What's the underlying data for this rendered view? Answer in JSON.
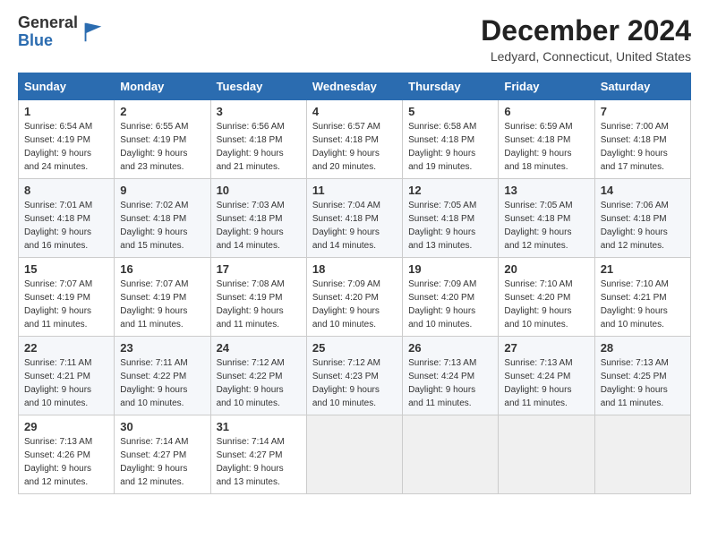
{
  "header": {
    "logo_line1": "General",
    "logo_line2": "Blue",
    "title": "December 2024",
    "subtitle": "Ledyard, Connecticut, United States"
  },
  "columns": [
    "Sunday",
    "Monday",
    "Tuesday",
    "Wednesday",
    "Thursday",
    "Friday",
    "Saturday"
  ],
  "weeks": [
    [
      {
        "day": "1",
        "sunrise": "6:54 AM",
        "sunset": "4:19 PM",
        "daylight": "9 hours and 24 minutes."
      },
      {
        "day": "2",
        "sunrise": "6:55 AM",
        "sunset": "4:19 PM",
        "daylight": "9 hours and 23 minutes."
      },
      {
        "day": "3",
        "sunrise": "6:56 AM",
        "sunset": "4:18 PM",
        "daylight": "9 hours and 21 minutes."
      },
      {
        "day": "4",
        "sunrise": "6:57 AM",
        "sunset": "4:18 PM",
        "daylight": "9 hours and 20 minutes."
      },
      {
        "day": "5",
        "sunrise": "6:58 AM",
        "sunset": "4:18 PM",
        "daylight": "9 hours and 19 minutes."
      },
      {
        "day": "6",
        "sunrise": "6:59 AM",
        "sunset": "4:18 PM",
        "daylight": "9 hours and 18 minutes."
      },
      {
        "day": "7",
        "sunrise": "7:00 AM",
        "sunset": "4:18 PM",
        "daylight": "9 hours and 17 minutes."
      }
    ],
    [
      {
        "day": "8",
        "sunrise": "7:01 AM",
        "sunset": "4:18 PM",
        "daylight": "9 hours and 16 minutes."
      },
      {
        "day": "9",
        "sunrise": "7:02 AM",
        "sunset": "4:18 PM",
        "daylight": "9 hours and 15 minutes."
      },
      {
        "day": "10",
        "sunrise": "7:03 AM",
        "sunset": "4:18 PM",
        "daylight": "9 hours and 14 minutes."
      },
      {
        "day": "11",
        "sunrise": "7:04 AM",
        "sunset": "4:18 PM",
        "daylight": "9 hours and 14 minutes."
      },
      {
        "day": "12",
        "sunrise": "7:05 AM",
        "sunset": "4:18 PM",
        "daylight": "9 hours and 13 minutes."
      },
      {
        "day": "13",
        "sunrise": "7:05 AM",
        "sunset": "4:18 PM",
        "daylight": "9 hours and 12 minutes."
      },
      {
        "day": "14",
        "sunrise": "7:06 AM",
        "sunset": "4:18 PM",
        "daylight": "9 hours and 12 minutes."
      }
    ],
    [
      {
        "day": "15",
        "sunrise": "7:07 AM",
        "sunset": "4:19 PM",
        "daylight": "9 hours and 11 minutes."
      },
      {
        "day": "16",
        "sunrise": "7:07 AM",
        "sunset": "4:19 PM",
        "daylight": "9 hours and 11 minutes."
      },
      {
        "day": "17",
        "sunrise": "7:08 AM",
        "sunset": "4:19 PM",
        "daylight": "9 hours and 11 minutes."
      },
      {
        "day": "18",
        "sunrise": "7:09 AM",
        "sunset": "4:20 PM",
        "daylight": "9 hours and 10 minutes."
      },
      {
        "day": "19",
        "sunrise": "7:09 AM",
        "sunset": "4:20 PM",
        "daylight": "9 hours and 10 minutes."
      },
      {
        "day": "20",
        "sunrise": "7:10 AM",
        "sunset": "4:20 PM",
        "daylight": "9 hours and 10 minutes."
      },
      {
        "day": "21",
        "sunrise": "7:10 AM",
        "sunset": "4:21 PM",
        "daylight": "9 hours and 10 minutes."
      }
    ],
    [
      {
        "day": "22",
        "sunrise": "7:11 AM",
        "sunset": "4:21 PM",
        "daylight": "9 hours and 10 minutes."
      },
      {
        "day": "23",
        "sunrise": "7:11 AM",
        "sunset": "4:22 PM",
        "daylight": "9 hours and 10 minutes."
      },
      {
        "day": "24",
        "sunrise": "7:12 AM",
        "sunset": "4:22 PM",
        "daylight": "9 hours and 10 minutes."
      },
      {
        "day": "25",
        "sunrise": "7:12 AM",
        "sunset": "4:23 PM",
        "daylight": "9 hours and 10 minutes."
      },
      {
        "day": "26",
        "sunrise": "7:13 AM",
        "sunset": "4:24 PM",
        "daylight": "9 hours and 11 minutes."
      },
      {
        "day": "27",
        "sunrise": "7:13 AM",
        "sunset": "4:24 PM",
        "daylight": "9 hours and 11 minutes."
      },
      {
        "day": "28",
        "sunrise": "7:13 AM",
        "sunset": "4:25 PM",
        "daylight": "9 hours and 11 minutes."
      }
    ],
    [
      {
        "day": "29",
        "sunrise": "7:13 AM",
        "sunset": "4:26 PM",
        "daylight": "9 hours and 12 minutes."
      },
      {
        "day": "30",
        "sunrise": "7:14 AM",
        "sunset": "4:27 PM",
        "daylight": "9 hours and 12 minutes."
      },
      {
        "day": "31",
        "sunrise": "7:14 AM",
        "sunset": "4:27 PM",
        "daylight": "9 hours and 13 minutes."
      },
      null,
      null,
      null,
      null
    ]
  ]
}
